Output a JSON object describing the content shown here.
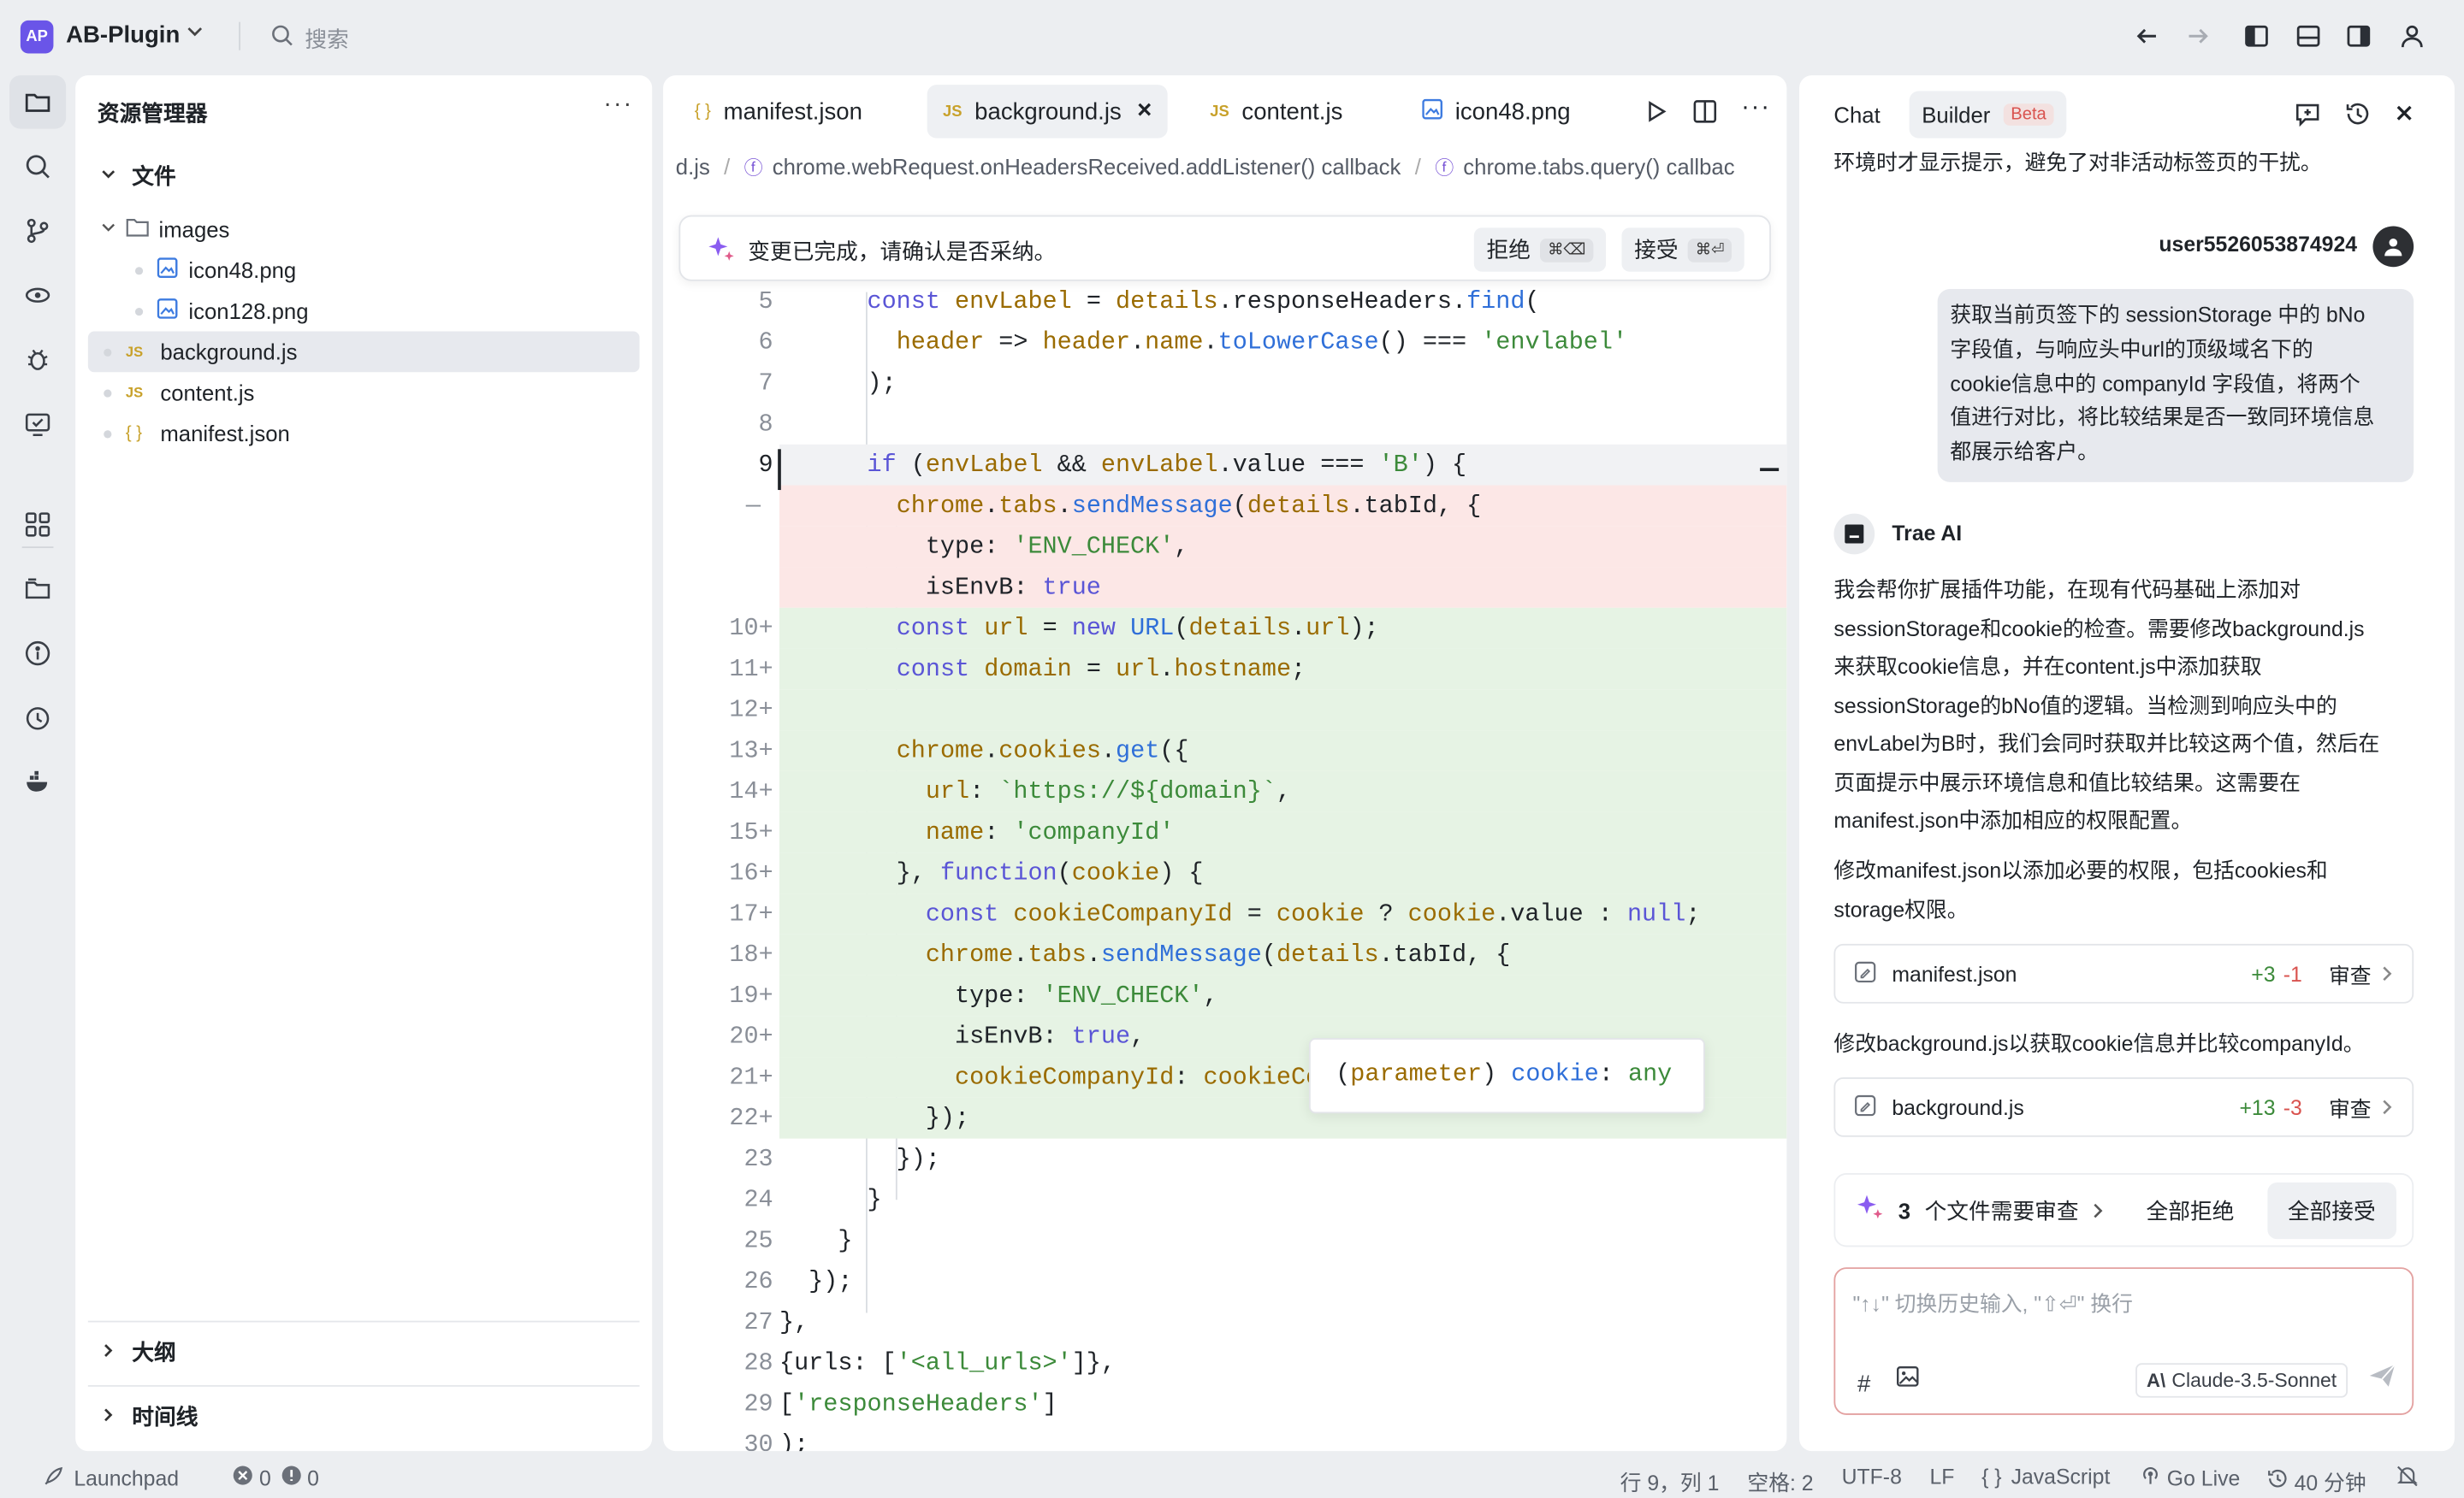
{
  "topbar": {
    "logo": "AP",
    "project": "AB-Plugin",
    "search_placeholder": "搜索"
  },
  "explorer": {
    "title": "资源管理器",
    "more": "···",
    "section_files": "文件",
    "folder": "images",
    "files": [
      {
        "name": "icon48.png",
        "type": "image"
      },
      {
        "name": "icon128.png",
        "type": "image"
      },
      {
        "name": "background.js",
        "type": "js",
        "selected": true
      },
      {
        "name": "content.js",
        "type": "js"
      },
      {
        "name": "manifest.json",
        "type": "json"
      }
    ],
    "outline": "大纲",
    "timeline": "时间线"
  },
  "editor": {
    "tabs": [
      {
        "label": "manifest.json",
        "tag": "{ }"
      },
      {
        "label": "background.js",
        "tag": "JS",
        "active": true,
        "close": "×"
      },
      {
        "label": "content.js",
        "tag": "JS"
      },
      {
        "label": "icon48.png",
        "tag": "img"
      }
    ],
    "breadcrumb": [
      "d.js",
      "chrome.webRequest.onHeadersReceived.addListener() callback",
      "chrome.tabs.query() callbac"
    ],
    "inline_prompt": {
      "text": "变更已完成，请确认是否采纳。",
      "reject": "拒绝",
      "reject_key": "⌘⌫",
      "accept": "接受",
      "accept_key": "⌘⏎"
    },
    "line_numbers": [
      "5",
      "6",
      "7",
      "8",
      "9",
      "",
      "",
      "",
      "10+",
      "11+",
      "12+",
      "13+",
      "14+",
      "15+",
      "16+",
      "17+",
      "18+",
      "19+",
      "20+",
      "21+",
      "22+",
      "23",
      "24",
      "25",
      "26",
      "27",
      "28",
      "29",
      "30"
    ],
    "deleted_marker": "—",
    "hover_tip": {
      "paren_open": "(",
      "kind": "parameter",
      "paren_close": ")",
      "name": "cookie",
      "colon": ":",
      "type": "any"
    },
    "code_lines": [
      "      const envLabel = details.responseHeaders.find(",
      "        header => header.name.toLowerCase() === 'envlabel'",
      "      );",
      "",
      "      if (envLabel && envLabel.value === 'B') {",
      "        chrome.tabs.sendMessage(details.tabId, {",
      "          type: 'ENV_CHECK',",
      "          isEnvB: true",
      "        const url = new URL(details.url);",
      "        const domain = url.hostname;",
      "",
      "        chrome.cookies.get({",
      "          url: `https://${domain}`,",
      "          name: 'companyId'",
      "        }, function(cookie) {",
      "          const cookieCompanyId = cookie ? cookie.value : null;",
      "          chrome.tabs.sendMessage(details.tabId, {",
      "            type: 'ENV_CHECK',",
      "            isEnvB: true,",
      "            cookieCompanyId: cookieCompanyId",
      "          });",
      "        });",
      "      }",
      "    }",
      "  });",
      "},",
      "{urls: ['<all_urls>']},",
      "['responseHeaders']",
      ");"
    ]
  },
  "chat": {
    "tabs": [
      "Chat",
      "Builder"
    ],
    "beta": "Beta",
    "prev_text": "环境时才显示提示，避免了对非活动标签页的干扰。",
    "user": "user5526053874924",
    "user_message_lines": [
      "获取当前页签下的 sessionStorage 中的 bNo",
      "字段值，与响应头中url的顶级域名下的",
      "cookie信息中的 companyId 字段值，将两个",
      "值进行对比，将比较结果是否一致同环境信息",
      "都展示给客户。"
    ],
    "ai_name": "Trae AI",
    "ai_paragraph_lines": [
      "我会帮你扩展插件功能，在现有代码基础上添加对",
      "sessionStorage和cookie的检查。需要修改background.js",
      "来获取cookie信息，并在content.js中添加获取",
      "sessionStorage的bNo值的逻辑。当检测到响应头中的",
      "envLabel为B时，我们会同时获取并比较这两个值，然后在",
      "页面提示中展示环境信息和值比较结果。这需要在",
      "manifest.json中添加相应的权限配置。"
    ],
    "step1_lines": [
      "修改manifest.json以添加必要的权限，包括cookies和",
      "storage权限。"
    ],
    "card1": {
      "file": "manifest.json",
      "plus": "+3",
      "minus": "-1",
      "review": "审查"
    },
    "step2": "修改background.js以获取cookie信息并比较companyId。",
    "card2": {
      "file": "background.js",
      "plus": "+13",
      "minus": "-3",
      "review": "审查"
    },
    "review_bar": {
      "count": "3",
      "label": "个文件需要审查",
      "reject_all": "全部拒绝",
      "accept_all": "全部接受"
    },
    "input_placeholder": "\"↑↓\" 切换历史输入, \"⇧⏎\" 换行",
    "hash": "#",
    "model": "Claude-3.5-Sonnet"
  },
  "statusbar": {
    "launchpad": "Launchpad",
    "errors": "0",
    "warnings": "0",
    "position": "行 9，列 1",
    "spaces": "空格: 2",
    "encoding": "UTF-8",
    "eol": "LF",
    "language_icon": "{ }",
    "language": "JavaScript",
    "golive": "Go Live",
    "time": "40 分钟"
  }
}
